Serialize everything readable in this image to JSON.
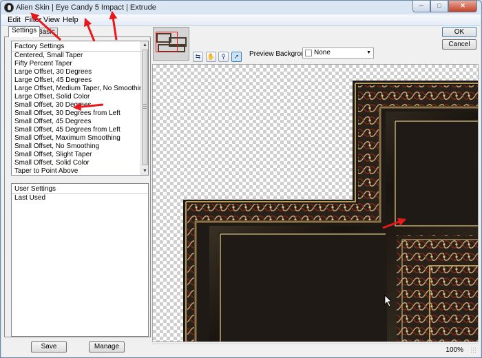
{
  "window": {
    "title": "Alien Skin | Eye Candy 5 Impact | Extrude",
    "buttons": {
      "minimize": "─",
      "maximize": "□",
      "close": "✕"
    }
  },
  "menu": [
    "Edit",
    "Filter",
    "View",
    "Help"
  ],
  "tabs": [
    "Settings",
    "Basic"
  ],
  "factory_settings": {
    "header": "Factory Settings",
    "items": [
      "Centered, Small Taper",
      "Fifty Percent Taper",
      "Large Offset, 30 Degrees",
      "Large Offset, 45 Degrees",
      "Large Offset, Medium Taper, No Smoothing",
      "Large Offset, Solid Color",
      "Small Offset, 30 Degrees",
      "Small Offset, 30 Degrees from Left",
      "Small Offset, 45 Degrees",
      "Small Offset, 45 Degrees from Left",
      "Small Offset, Maximum Smoothing",
      "Small Offset, No Smoothing",
      "Small Offset, Slight Taper",
      "Small Offset, Solid Color",
      "Taper to Point Above"
    ]
  },
  "user_settings": {
    "header": "User Settings",
    "items": [
      "Last Used"
    ]
  },
  "buttons": {
    "save": "Save",
    "manage": "Manage",
    "ok": "OK",
    "cancel": "Cancel"
  },
  "preview_background": {
    "label": "Preview Background:",
    "value": "None"
  },
  "zoom": "100%",
  "colors": {
    "annotation_arrow": "#e8191c",
    "frame_dark": "#1f1a15",
    "frame_gold": "#b79a5e",
    "frame_red": "#7a1d10"
  }
}
